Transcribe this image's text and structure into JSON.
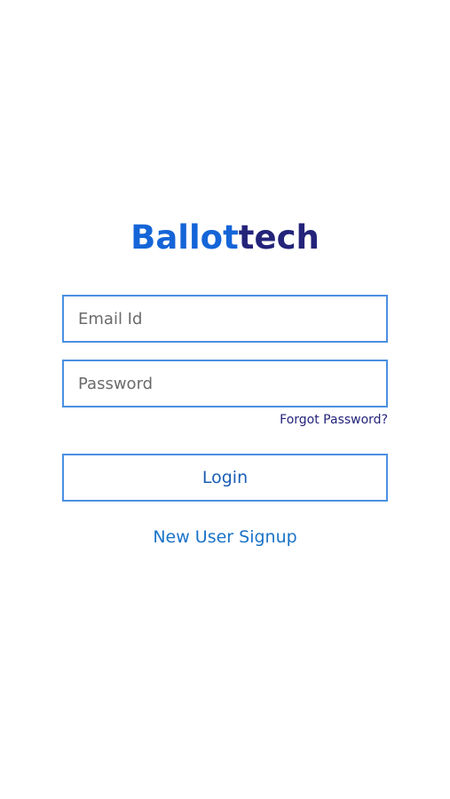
{
  "logo": {
    "part1": "Ballot",
    "part2": "tech",
    "color_part1": "#1565d8",
    "color_part2": "#23237a"
  },
  "form": {
    "email_placeholder": "Email Id",
    "email_value": "",
    "password_placeholder": "Password",
    "password_value": "",
    "forgot_label": "Forgot Password?",
    "login_label": "Login",
    "signup_label": "New User Signup"
  },
  "colors": {
    "accent_border": "#4a90e2",
    "link": "#1a73c8"
  }
}
